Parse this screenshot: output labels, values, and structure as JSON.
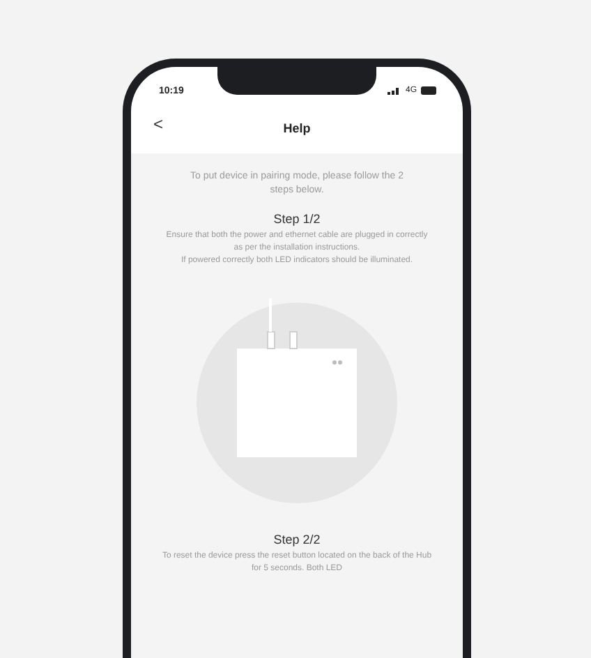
{
  "status_bar": {
    "time": "10:19",
    "network": "4G"
  },
  "nav": {
    "back": "<",
    "title": "Help"
  },
  "intro": "To put device in pairing mode, please follow the 2 steps below.",
  "steps": [
    {
      "title": "Step 1/2",
      "lines": [
        "Ensure that both the power and ethernet cable are plugged in correctly as per the installation instructions.",
        "If powered correctly both LED indicators should be illuminated."
      ],
      "illustration": true
    },
    {
      "title": "Step 2/2",
      "lines": [
        "To reset the device press the reset button located on the back of the Hub for 5 seconds. Both LED"
      ],
      "illustration": false
    }
  ]
}
